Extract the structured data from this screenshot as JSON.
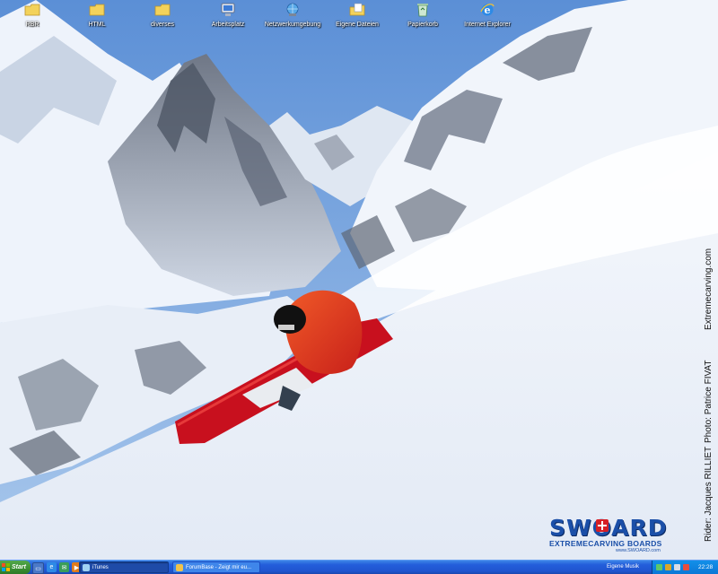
{
  "desktop": {
    "icons": [
      {
        "label": "RBR",
        "icon": "folder-icon"
      },
      {
        "label": "HTML",
        "icon": "folder-icon"
      },
      {
        "label": "diverses",
        "icon": "folder-icon"
      },
      {
        "label": "Arbeitsplatz",
        "icon": "my-computer-icon"
      },
      {
        "label": "Netzwerkumgebung",
        "icon": "network-places-icon"
      },
      {
        "label": "Eigene Dateien",
        "icon": "my-documents-icon"
      },
      {
        "label": "Papierkorb",
        "icon": "recycle-bin-icon"
      },
      {
        "label": "Internet Explorer",
        "icon": "internet-explorer-icon"
      }
    ],
    "wallpaper": {
      "credits": {
        "rider": "Rider: Jacques RILLIET",
        "photo": "Photo: Patrice FIVAT",
        "site": "Extremecarving.com"
      },
      "logo": {
        "brand": "SWOARD",
        "tagline": "EXTREMECARVING BOARDS",
        "url": "www.SWOARD.com"
      }
    }
  },
  "taskbar": {
    "start_label": "Start",
    "quick_launch": [
      "show-desktop-icon",
      "internet-explorer-icon",
      "outlook-express-icon",
      "media-player-icon"
    ],
    "buttons": [
      {
        "label": "iTunes",
        "icon": "itunes-icon",
        "active": true
      },
      {
        "label": "ForumBase - Zeigt mir eu...",
        "icon": "browser-window-icon",
        "active": false
      }
    ],
    "tray": {
      "music_label": "Eigene Musik",
      "icons": [
        "network-tray-icon",
        "security-tray-icon",
        "volume-tray-icon",
        "messenger-tray-icon"
      ],
      "clock": "22:28"
    }
  },
  "colors": {
    "taskbar": "#245edb",
    "start_button": "#3a8e32",
    "brand_blue": "#1b4fa8",
    "sky": "#7aa4d8"
  }
}
